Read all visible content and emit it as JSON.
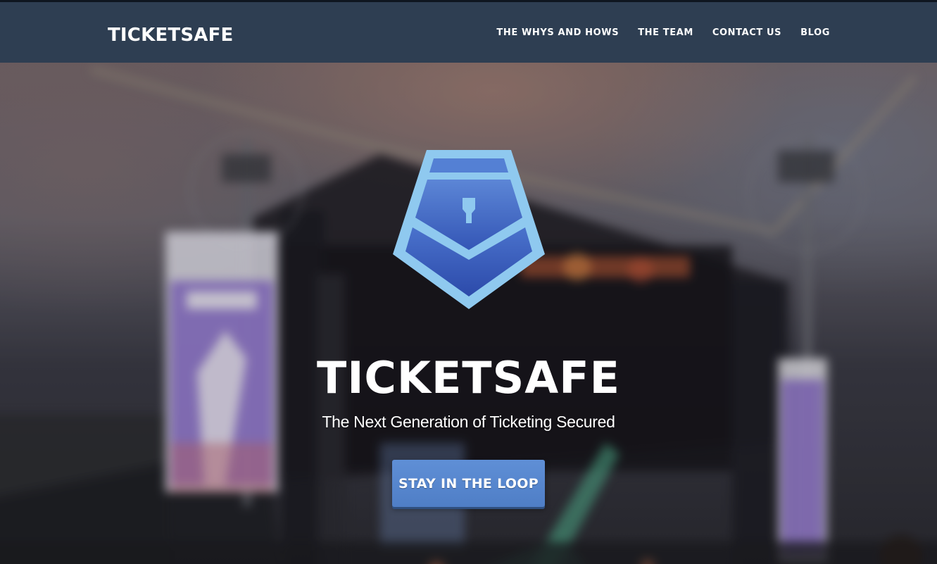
{
  "brand": {
    "name": "TICKETSAFE"
  },
  "nav": {
    "items": [
      {
        "label": "THE WHYS AND HOWS"
      },
      {
        "label": "THE TEAM"
      },
      {
        "label": "CONTACT US"
      },
      {
        "label": "BLOG"
      }
    ]
  },
  "hero": {
    "title": "TICKETSAFE",
    "subtitle": "The Next Generation of Ticketing Secured",
    "cta_label": "STAY IN THE LOOP",
    "logo_icon": "ticket-shield-lock-icon",
    "background": "blurred-concert-stage-photo"
  },
  "colors": {
    "navbar": "#2e3e52",
    "cta": "#5a88d0",
    "logo_light": "#8fc8ee",
    "logo_dark": "#3c5fbd"
  }
}
